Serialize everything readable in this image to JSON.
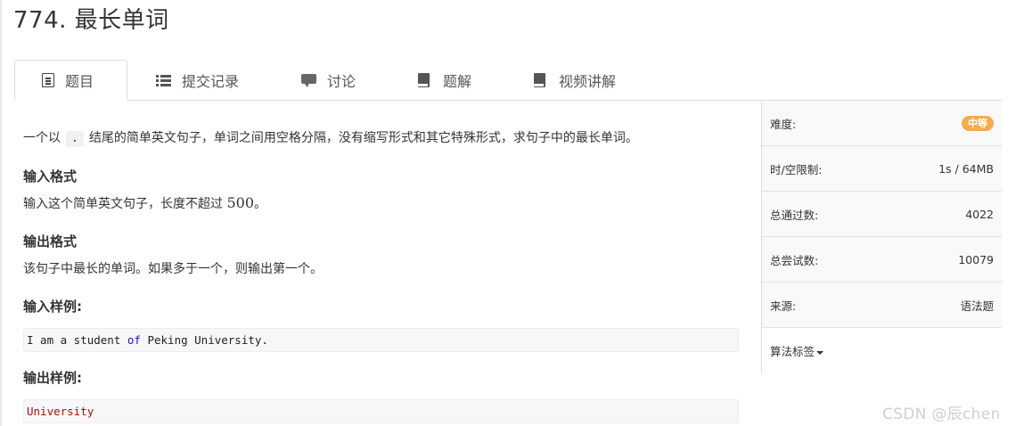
{
  "title": "774. 最长单词",
  "tabs": [
    {
      "label": "题目",
      "icon": "doc-icon",
      "active": true
    },
    {
      "label": "提交记录",
      "icon": "list-icon"
    },
    {
      "label": "讨论",
      "icon": "chat-icon"
    },
    {
      "label": "题解",
      "icon": "book-icon"
    },
    {
      "label": "视频讲解",
      "icon": "book-icon"
    }
  ],
  "problem": {
    "intro_before": "一个以",
    "intro_code": ".",
    "intro_after": "结尾的简单英文句子，单词之间用空格分隔，没有缩写形式和其它特殊形式，求句子中的最长单词。",
    "input_format_title": "输入格式",
    "input_format_text": "输入这个简单英文句子，长度不超过",
    "input_format_num": "500",
    "input_format_end": "。",
    "output_format_title": "输出格式",
    "output_format_text": "该句子中最长的单词。如果多于一个，则输出第一个。",
    "sample_input_title": "输入样例:",
    "sample_input_pre": "I am a student ",
    "sample_input_kw": "of",
    "sample_input_post": " Peking University.",
    "sample_output_title": "输出样例:",
    "sample_output": "University"
  },
  "info": {
    "difficulty_label": "难度:",
    "difficulty_value": "中等",
    "limit_label": "时/空限制:",
    "limit_value": "1s / 64MB",
    "passed_label": "总通过数:",
    "passed_value": "4022",
    "tried_label": "总尝试数:",
    "tried_value": "10079",
    "source_label": "来源:",
    "source_value": "语法题",
    "tags_label": "算法标签"
  },
  "watermark": "CSDN @辰chen",
  "colors": {
    "badge": "#f0ad4e",
    "keyword": "#1a1aa6",
    "output": "#aa1111"
  }
}
